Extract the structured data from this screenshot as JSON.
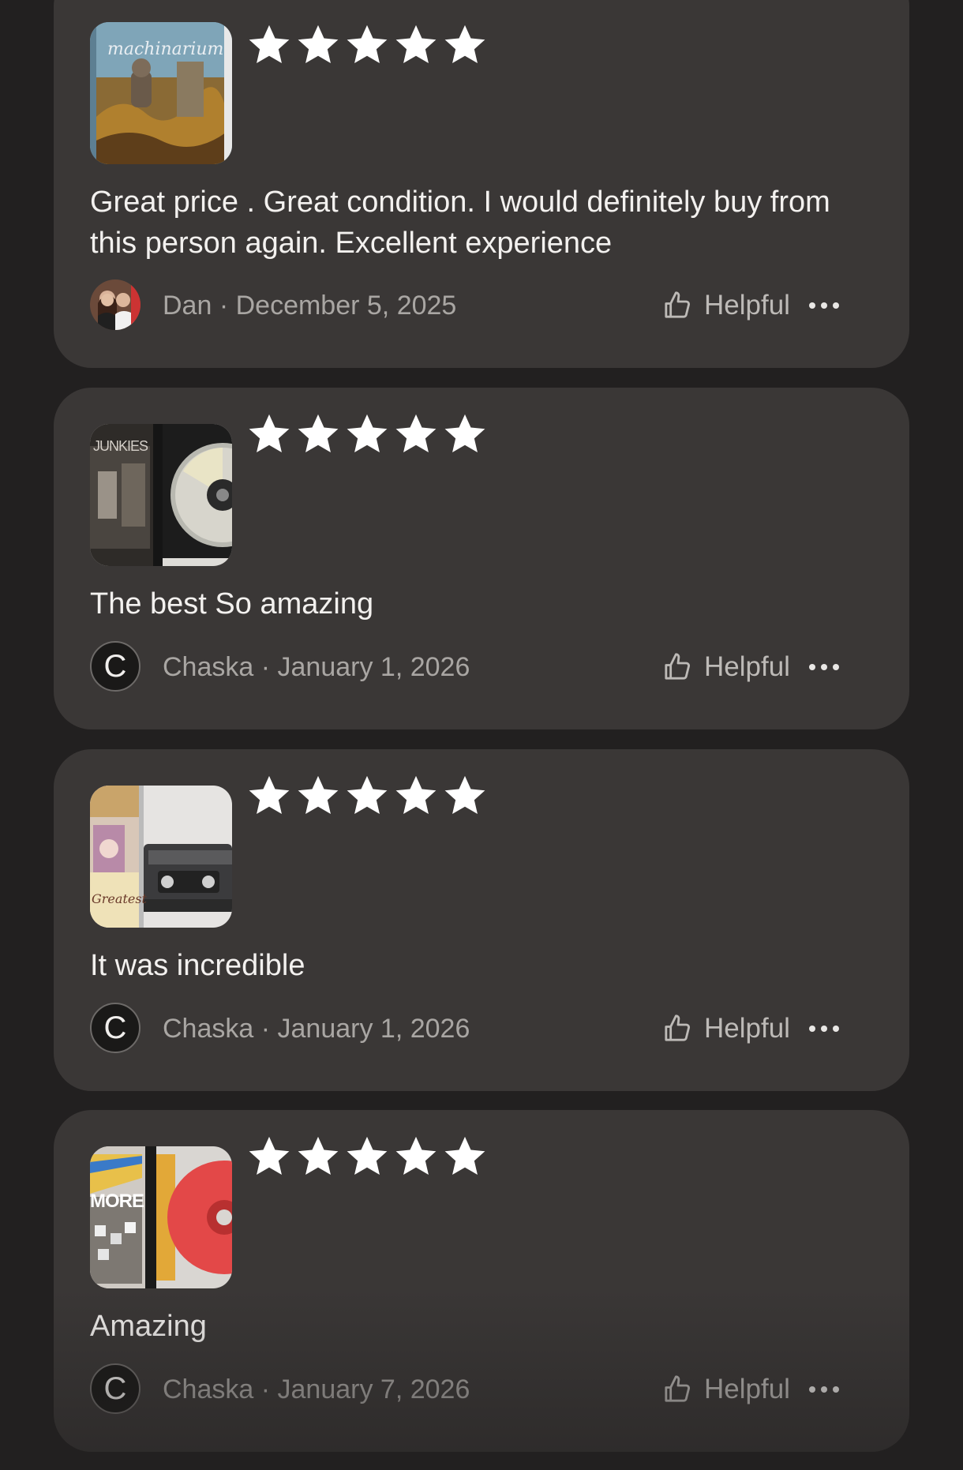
{
  "colors": {
    "page_background": "#222020",
    "card_background": "#3a3736",
    "star": "#ffffff",
    "text": "#f3f1ef",
    "muted_text": "#a9a6a3"
  },
  "reviews": [
    {
      "rating": 5,
      "thumbnail_icon": "machinarium-cover-image",
      "thumbnail_label": "machinarium",
      "text": "Great price . Great condition. I would definitely buy from this person again. Excellent experience",
      "reviewer": "Dan",
      "separator": "·",
      "date": "December 5, 2025",
      "avatar": "photo-avatar",
      "helpful_label": "Helpful",
      "more_icon": "more-dots-icon"
    },
    {
      "rating": 5,
      "thumbnail_icon": "cd-case-image",
      "thumbnail_label": "JUNKIES",
      "text": "The best So amazing",
      "reviewer": "Chaska",
      "separator": "·",
      "date": "January 1, 2026",
      "avatar_letter": "C",
      "helpful_label": "Helpful",
      "more_icon": "more-dots-icon"
    },
    {
      "rating": 5,
      "thumbnail_icon": "cassette-tape-image",
      "thumbnail_label": "Greatest",
      "text": "It was incredible",
      "reviewer": "Chaska",
      "separator": "·",
      "date": "January 1, 2026",
      "avatar_letter": "C",
      "helpful_label": "Helpful",
      "more_icon": "more-dots-icon"
    },
    {
      "rating": 5,
      "thumbnail_icon": "red-cd-image",
      "thumbnail_label": "MORE",
      "text": "Amazing",
      "reviewer": "Chaska",
      "separator": "·",
      "date": "January 7, 2026",
      "avatar_letter": "C",
      "helpful_label": "Helpful",
      "more_icon": "more-dots-icon"
    }
  ]
}
